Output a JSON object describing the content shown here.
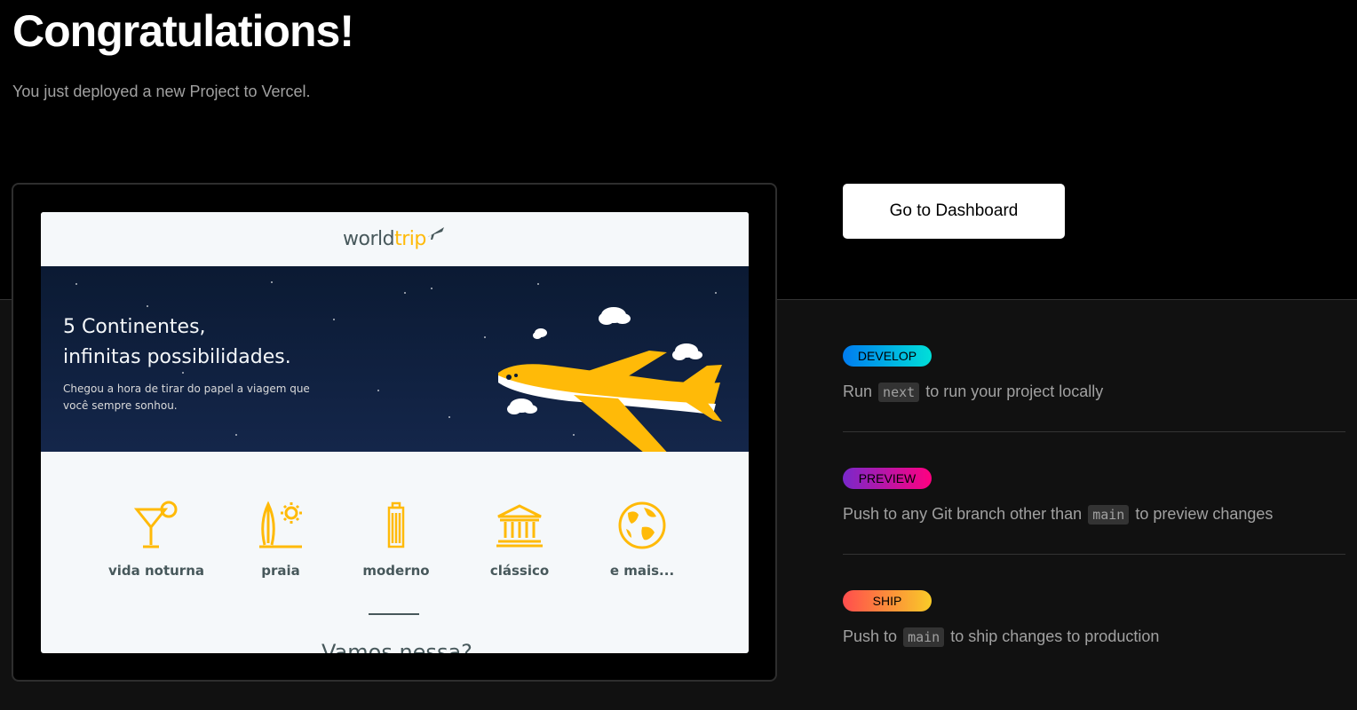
{
  "header": {
    "title": "Congratulations!",
    "subtitle": "You just deployed a new Project to Vercel."
  },
  "preview": {
    "logo": {
      "text_main": "world",
      "text_accent": "trip"
    },
    "banner": {
      "title_line1": "5 Continentes,",
      "title_line2": "infinitas possibilidades.",
      "text": "Chegou a hora de tirar do papel a viagem que você sempre sonhou."
    },
    "travel_types": [
      {
        "label": "vida noturna",
        "icon": "cocktail-icon"
      },
      {
        "label": "praia",
        "icon": "surf-icon"
      },
      {
        "label": "moderno",
        "icon": "building-icon"
      },
      {
        "label": "clássico",
        "icon": "museum-icon"
      },
      {
        "label": "e mais...",
        "icon": "globe-icon"
      }
    ],
    "cut_heading": "Vamos nessa?"
  },
  "dashboard_button": {
    "label": "Go to Dashboard"
  },
  "steps": [
    {
      "badge": "DEVELOP",
      "text_before": "Run",
      "code": "next",
      "text_after": "to run your project locally"
    },
    {
      "badge": "PREVIEW",
      "text_before": "Push to any Git branch other than",
      "code": "main",
      "text_after": "to preview changes"
    },
    {
      "badge": "SHIP",
      "text_before": "Push to",
      "code": "main",
      "text_after": "to ship changes to production"
    }
  ],
  "colors": {
    "accent_yellow": "#ffba08",
    "develop_gradient": [
      "#007cf0",
      "#00dfd8"
    ],
    "preview_gradient": [
      "#7928ca",
      "#ff0080"
    ],
    "ship_gradient": [
      "#ff4d4d",
      "#f9cb28"
    ]
  }
}
